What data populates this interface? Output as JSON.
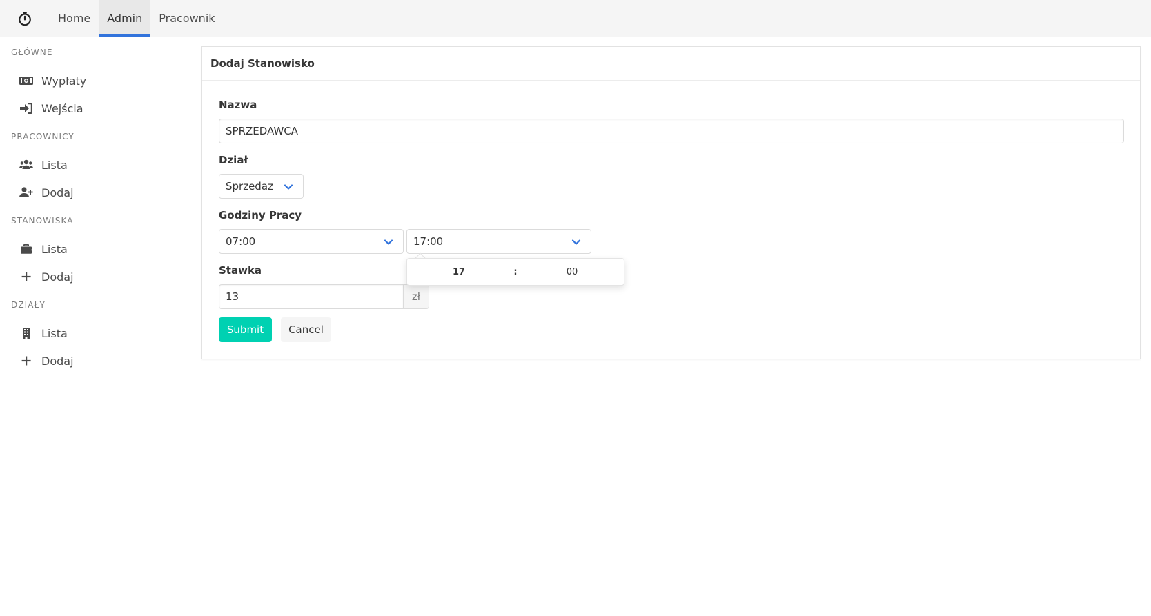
{
  "navbar": {
    "brand_icon": "stopwatch-icon",
    "items": [
      {
        "label": "Home"
      },
      {
        "label": "Admin",
        "active": true
      },
      {
        "label": "Pracownik"
      }
    ],
    "accent_color": "#3273dc"
  },
  "sidebar": {
    "sections": [
      {
        "label": "GŁÓWNE",
        "items": [
          {
            "label": "Wypłaty",
            "icon": "money-bill-icon"
          },
          {
            "label": "Wejścia",
            "icon": "sign-in-icon"
          }
        ]
      },
      {
        "label": "PRACOWNICY",
        "items": [
          {
            "label": "Lista",
            "icon": "users-icon"
          },
          {
            "label": "Dodaj",
            "icon": "user-plus-icon"
          }
        ]
      },
      {
        "label": "STANOWISKA",
        "items": [
          {
            "label": "Lista",
            "icon": "briefcase-icon"
          },
          {
            "label": "Dodaj",
            "icon": "plus-icon"
          }
        ]
      },
      {
        "label": "DZIAŁY",
        "items": [
          {
            "label": "Lista",
            "icon": "building-icon"
          },
          {
            "label": "Dodaj",
            "icon": "plus-icon"
          }
        ]
      }
    ]
  },
  "form": {
    "title": "Dodaj Stanowisko",
    "name_label": "Nazwa",
    "name_value": "SPRZEDAWCA",
    "department_label": "Dział",
    "department_value": "Sprzedaz",
    "hours_label": "Godziny Pracy",
    "hours_from": "07:00",
    "hours_to": "17:00",
    "time_picker": {
      "hour": "17",
      "separator": ":",
      "minute": "00"
    },
    "rate_label": "Stawka",
    "rate_value": "13",
    "rate_unit": "zł",
    "submit_label": "Submit",
    "cancel_label": "Cancel",
    "submit_color": "#00d1b2"
  }
}
